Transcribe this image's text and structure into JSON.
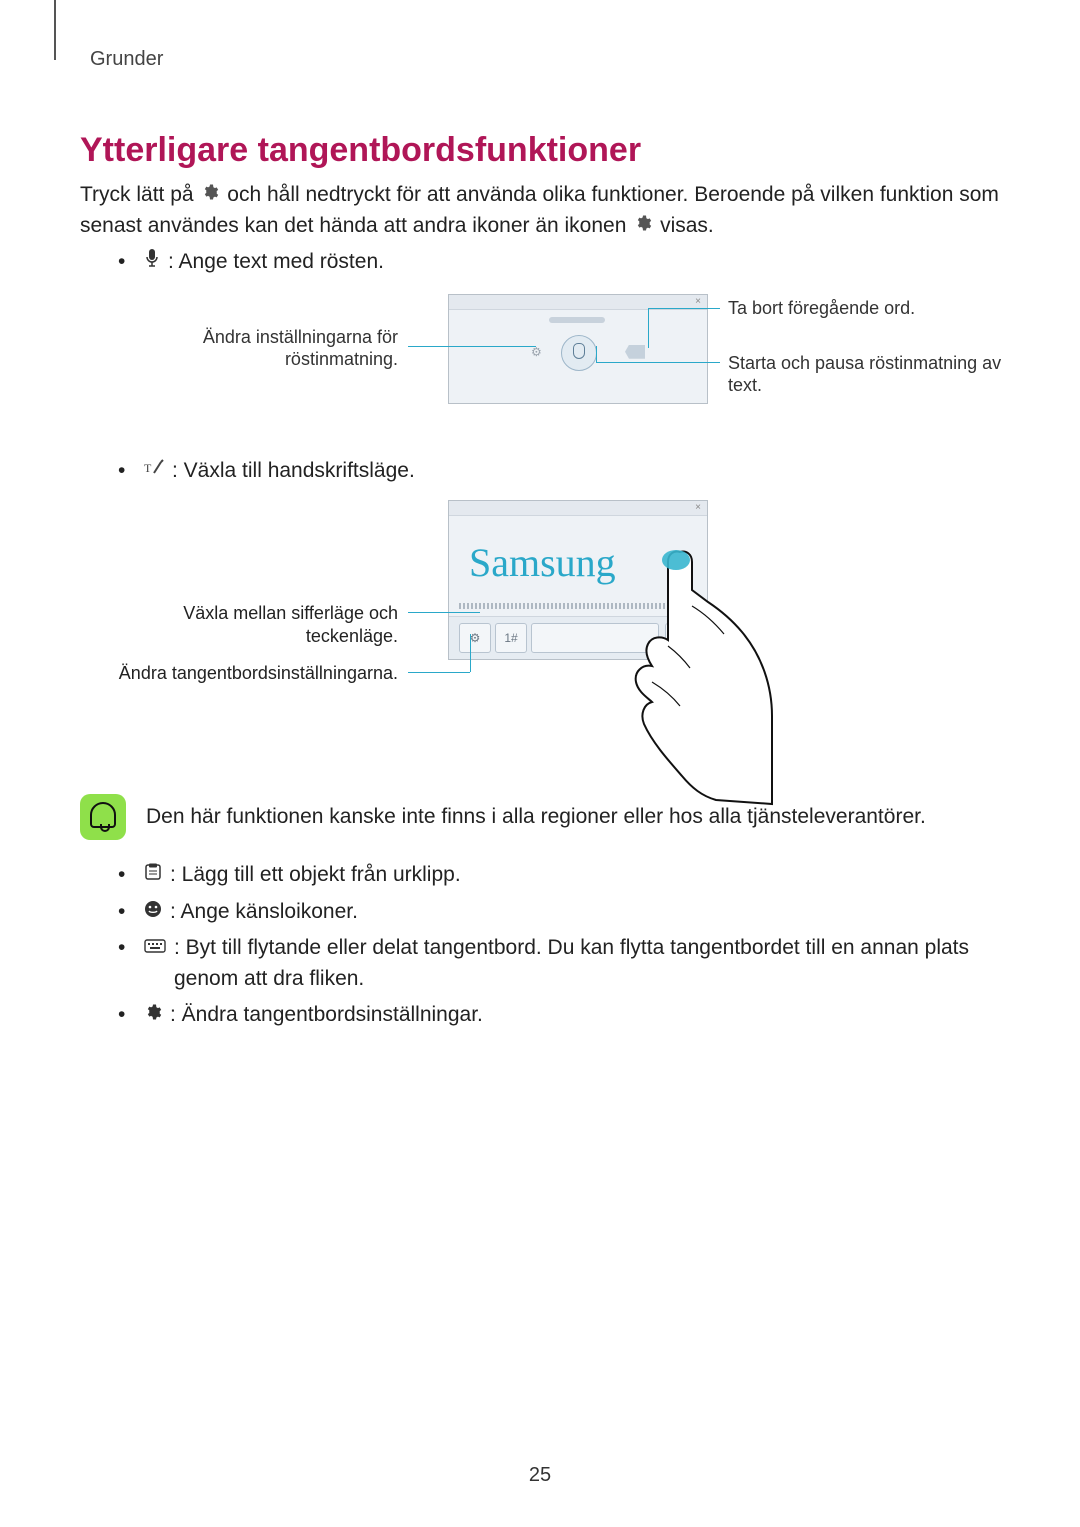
{
  "header": "Grunder",
  "title": "Ytterligare tangentbordsfunktioner",
  "intro_pre": "Tryck lätt på ",
  "intro_mid": " och håll nedtryckt för att använda olika funktioner. Beroende på vilken funktion som senast användes kan det hända att andra ikoner än ikonen ",
  "intro_post": " visas.",
  "bullets1": {
    "voice": " : Ange text med rösten."
  },
  "fig1": {
    "left": "Ändra inställningarna för röstinmatning.",
    "r1": "Ta bort föregående ord.",
    "r2": "Starta och pausa röstinmatning av text."
  },
  "bullets2": {
    "handwriting": " : Växla till handskriftsläge."
  },
  "fig2": {
    "word": "Samsung",
    "left1": "Växla mellan sifferläge och teckenläge.",
    "left2": "Ändra tangentbordsinställningarna."
  },
  "note": "Den här funktionen kanske inte finns i alla regioner eller hos alla tjänsteleverantörer.",
  "bullets3": {
    "clip": " : Lägg till ett objekt från urklipp.",
    "emoji": " : Ange känsloikoner.",
    "float": " : Byt till flytande eller delat tangentbord. Du kan flytta tangentbordet till en annan plats genom att dra fliken.",
    "settings": " : Ändra tangentbordsinställningar."
  },
  "page_number": "25"
}
